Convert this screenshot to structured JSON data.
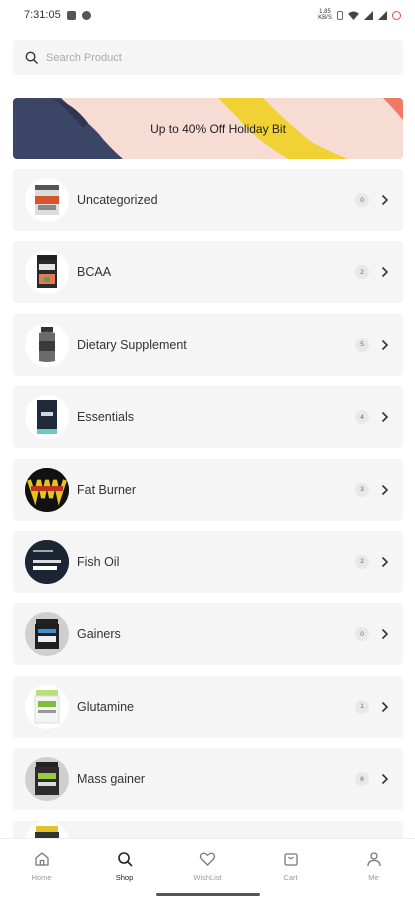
{
  "status_bar": {
    "time": "7:31:05",
    "speed": "1.85 KB/S"
  },
  "search": {
    "placeholder": "Search Product"
  },
  "banner": {
    "text": "Up to 40% Off Holiday Bit"
  },
  "categories": [
    {
      "name": "Uncategorized",
      "count": "0",
      "thumb": "protein-tub-icon"
    },
    {
      "name": "BCAA",
      "count": "2",
      "thumb": "bcaa-tub-icon"
    },
    {
      "name": "Dietary Supplement",
      "count": "5",
      "thumb": "supplement-jar-icon"
    },
    {
      "name": "Essentials",
      "count": "4",
      "thumb": "essentials-box-icon"
    },
    {
      "name": "Fat Burner",
      "count": "3",
      "thumb": "fat-burner-pack-icon"
    },
    {
      "name": "Fish Oil",
      "count": "2",
      "thumb": "fish-oil-pack-icon"
    },
    {
      "name": "Gainers",
      "count": "0",
      "thumb": "gainer-tub-icon"
    },
    {
      "name": "Glutamine",
      "count": "1",
      "thumb": "glutamine-tub-icon"
    },
    {
      "name": "Mass gainer",
      "count": "6",
      "thumb": "mass-gainer-tub-icon"
    }
  ],
  "nav": {
    "home": "Home",
    "shop": "Shop",
    "wishlist": "WishList",
    "cart": "Cart",
    "me": "Me"
  },
  "colors": {
    "banner_bg": "#f6dcd3",
    "banner_navy": "#3b4566",
    "banner_yellow": "#f1d234",
    "banner_coral": "#f07a62",
    "row_bg": "#f5f5f5"
  }
}
